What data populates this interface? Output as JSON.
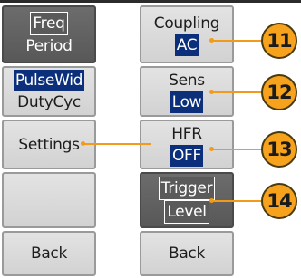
{
  "menu_left": {
    "freq_period": {
      "line1": "Freq",
      "line2": "Period"
    },
    "pulsewid_dutycyc": {
      "line1": "PulseWid",
      "line2": "DutyCyc"
    },
    "settings": {
      "label": "Settings"
    },
    "back": {
      "label": "Back"
    }
  },
  "menu_right": {
    "coupling": {
      "label": "Coupling",
      "value": "AC"
    },
    "sens": {
      "label": "Sens",
      "value": "Low"
    },
    "hfr": {
      "label": "HFR",
      "value": "OFF"
    },
    "trigger_level": {
      "line1": "Trigger",
      "line2": "Level"
    },
    "back": {
      "label": "Back"
    }
  },
  "callouts": [
    "11",
    "12",
    "13",
    "14"
  ],
  "colors": {
    "accent": "#f6a21d",
    "selection": "#0b2f7a",
    "button_face": "#dcdcdc",
    "button_active": "#636363"
  }
}
